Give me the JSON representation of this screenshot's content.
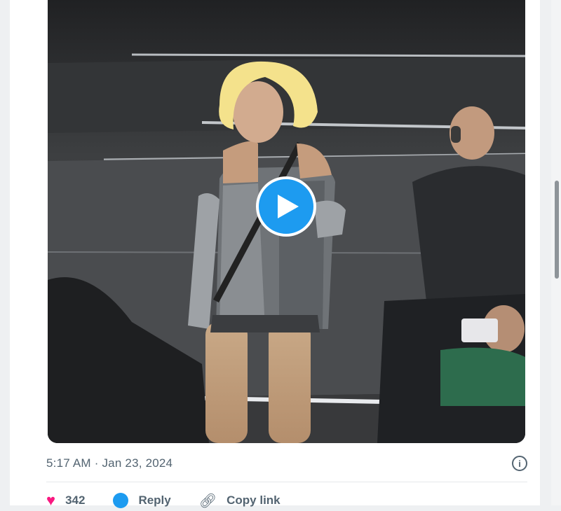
{
  "tweet": {
    "timestamp": "5:17 AM · Jan 23, 2024",
    "info_icon": "info-icon"
  },
  "video": {
    "play_icon": "play-icon",
    "accent_color": "#1d9bf0"
  },
  "actions": {
    "like_count": "342",
    "reply_label": "Reply",
    "copy_link_label": "Copy link"
  },
  "colors": {
    "like": "#f91880",
    "secondary_text": "#536471"
  }
}
